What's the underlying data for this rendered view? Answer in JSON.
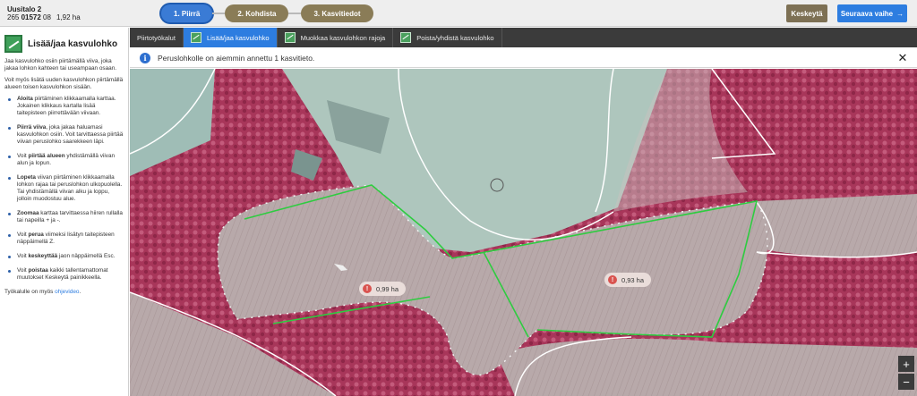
{
  "parcel": {
    "name": "Uusitalo 2",
    "id_prefix": "265 ",
    "id_bold": "01572",
    "id_suffix": " 08",
    "area": "1,92 ha"
  },
  "steps": [
    {
      "label": "1. Piirrä",
      "active": true
    },
    {
      "label": "2. Kohdista",
      "active": false
    },
    {
      "label": "3. Kasvitiedot",
      "active": false
    }
  ],
  "buttons": {
    "cancel": "Keskeytä",
    "next": "Seuraava vaihe",
    "next_arrow": "→"
  },
  "sidebar": {
    "title": "Lisää/jaa kasvulohko",
    "intro1": "Jaa kasvulohko osiin piirtämällä viiva, joka jakaa lohkon kahteen tai useampaan osaan.",
    "intro2": "Voit myös lisätä uuden kasvulohkon piirtämällä alueen toisen kasvulohkon sisään.",
    "items": [
      {
        "bold": "Aloita",
        "text": " piirtäminen klikkaamalla karttaa. Jokainen klikkaus kartalla lisää taitepisteen piirrettävään viivaan."
      },
      {
        "bold": "Piirrä viiva",
        "text": ", joka jakaa haluamasi kasvulohkon osiin. Voit tarvittaessa piirtää viivan peruslohko saarekkeen läpi."
      },
      {
        "pre": "Voit ",
        "bold": "piirtää alueen",
        "text": " yhdistämällä viivan alun ja lopun."
      },
      {
        "bold": "Lopeta",
        "text": " viivan piirtäminen klikkaamalla lohkon rajaa tai peruslohkon ulkopuolella. Tai yhdistämällä viivan alku ja loppu, jolloin muodostuu alue."
      },
      {
        "bold": "Zoomaa",
        "text": " karttaa tarvittaessa hiiren rullalla tai napeilla + ja -."
      },
      {
        "pre": "Voit ",
        "bold": "perua",
        "text": " viimeksi lisätyn taitepisteen näppäimellä Z."
      },
      {
        "pre": "Voit ",
        "bold": "keskeyttää",
        "text": " jaon näppäimellä Esc."
      },
      {
        "pre": "Voit ",
        "bold": "poistaa",
        "text": " kaikki tallentamattomat muutokset Keskeytä painikkeella."
      }
    ],
    "footer_text": "Työkalulle on myös ",
    "footer_link": "ohjevideo",
    "footer_end": "."
  },
  "toolbar": [
    {
      "label": "Piirtotyökalut",
      "icon": false,
      "active": false
    },
    {
      "label": "Lisää/jaa kasvulohko",
      "icon": true,
      "active": true
    },
    {
      "label": "Muokkaa kasvulohkon rajoja",
      "icon": true,
      "active": false
    },
    {
      "label": "Poista/yhdistä kasvulohko",
      "icon": true,
      "active": false
    }
  ],
  "info": {
    "message": "Peruslohkolle on aiemmin annettu 1 kasvitieto.",
    "icon": "info-icon",
    "close": "✕"
  },
  "map": {
    "labels": [
      {
        "value": "0,99 ha"
      },
      {
        "value": "0,93 ha"
      }
    ],
    "zoom_in": "+",
    "zoom_out": "−",
    "colors": {
      "field": "#b7a7a8",
      "forest": "#b0375a",
      "boundary": "#ffffff",
      "draw_line": "#2ecc40"
    }
  }
}
